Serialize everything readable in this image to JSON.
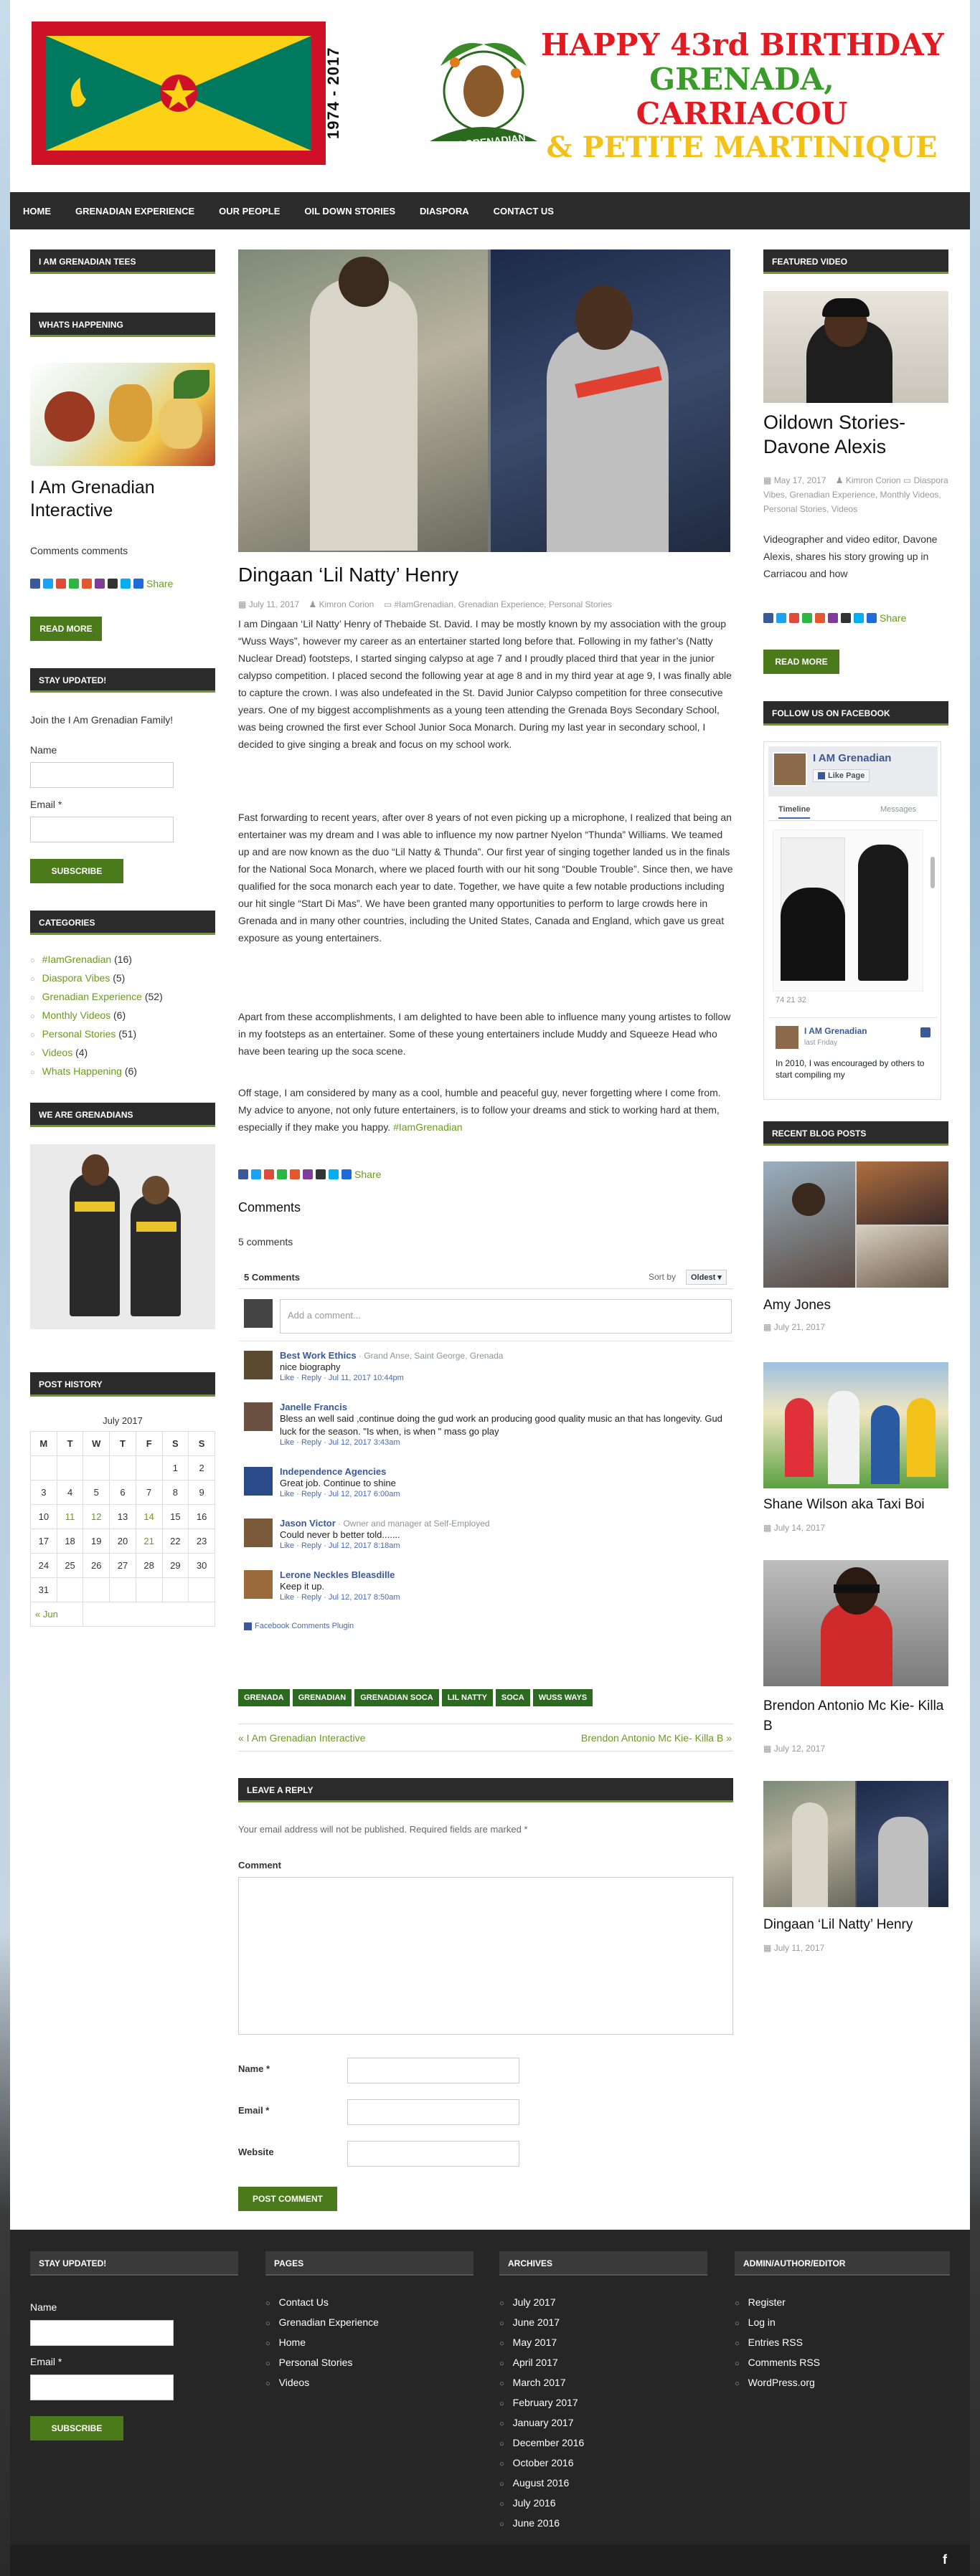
{
  "header": {
    "years": "1974 - 2017",
    "logo_text": "I AM GRENADIAN",
    "line1": "HAPPY 43rd BIRTHDAY",
    "line2": "GRENADA,",
    "line3": "CARRIACOU",
    "line4": "& PETITE MARTINIQUE"
  },
  "nav": [
    "HOME",
    "GRENADIAN EXPERIENCE",
    "OUR PEOPLE",
    "OIL DOWN STORIES",
    "DIASPORA",
    "CONTACT US"
  ],
  "left": {
    "tees_title": "I AM GRENADIAN TEES",
    "happening_title": "WHATS HAPPENING",
    "happening_post": "I Am Grenadian Interactive",
    "happening_comments": "Comments comments",
    "share": "Share",
    "read_more": "READ MORE",
    "stay_title": "STAY UPDATED!",
    "stay_text": "Join the I Am Grenadian Family!",
    "name_label": "Name",
    "email_label": "Email *",
    "subscribe": "SUBSCRIBE",
    "categories_title": "CATEGORIES",
    "categories": [
      {
        "name": "#IamGrenadian",
        "count": "(16)"
      },
      {
        "name": "Diaspora Vibes",
        "count": "(5)"
      },
      {
        "name": "Grenadian Experience",
        "count": "(52)"
      },
      {
        "name": "Monthly Videos",
        "count": "(6)"
      },
      {
        "name": "Personal Stories",
        "count": "(51)"
      },
      {
        "name": "Videos",
        "count": "(4)"
      },
      {
        "name": "Whats Happening",
        "count": "(6)"
      }
    ],
    "we_are_title": "WE ARE GRENADIANS",
    "history_title": "POST HISTORY",
    "cal_caption": "July 2017",
    "cal_head": [
      "M",
      "T",
      "W",
      "T",
      "F",
      "S",
      "S"
    ],
    "cal_rows": [
      [
        "",
        "",
        "",
        "",
        "",
        "1",
        "2"
      ],
      [
        "3",
        "4",
        "5",
        "6",
        "7",
        "8",
        "9"
      ],
      [
        "10",
        "11",
        "12",
        "13",
        "14",
        "15",
        "16"
      ],
      [
        "17",
        "18",
        "19",
        "20",
        "21",
        "22",
        "23"
      ],
      [
        "24",
        "25",
        "26",
        "27",
        "28",
        "29",
        "30"
      ],
      [
        "31",
        "",
        "",
        "",
        "",
        "",
        ""
      ]
    ],
    "cal_prev": "« Jun"
  },
  "post": {
    "title": "Dingaan ‘Lil Natty’ Henry",
    "date": "July 11, 2017",
    "author": "Kimron Corion",
    "cats": "#IamGrenadian, Grenadian Experience, Personal Stories",
    "p1": "I am Dingaan ‘Lil Natty’ Henry of Thebaide St. David. I may be mostly known by my association with the group “Wuss Ways”, however my career as an entertainer started long before that. Following in my father’s (Natty Nuclear Dread) footsteps, I started singing calypso at age 7 and I proudly placed third that year in the junior calypso competition. I placed second the following year at age 8 and in my third year at age 9, I was finally able to capture the crown. I was also undefeated in the St. David Junior Calypso competition for three consecutive years. One of my biggest accomplishments as a young teen attending the Grenada Boys Secondary School, was being crowned the first ever School Junior Soca Monarch. During my last year in secondary school, I decided to give singing a break and focus on my school work.",
    "p2": "Fast forwarding to recent years, after over 8 years of not even picking up a microphone, I realized that being an entertainer was my dream and I was able to influence my now partner Nyelon “Thunda” Williams. We teamed up and are now known as the duo “Lil Natty & Thunda”. Our first year of singing together landed us in the finals for the National Soca Monarch, where we placed fourth with our hit song “Double Trouble”. Since then, we have qualified for the soca monarch each year to date. Together, we have quite a few notable productions including our hit single “Start Di Mas”. We have been granted many opportunities to perform to large crowds here in Grenada and in many other countries, including the United States, Canada and England, which gave us great exposure as young entertainers.",
    "p3": "Apart from these accomplishments, I am delighted to have been able to influence many young artistes to follow in my footsteps as an entertainer. Some of these young entertainers include Muddy and Squeeze Head who have been tearing up the soca scene.",
    "p4a": "Off stage, I am considered by many as a cool, humble and peaceful guy, never forgetting where I come from. My advice to anyone, not only future entertainers, is to follow your dreams and stick to working hard at them, especially if they make you happy.",
    "p4b": "#IamGrenadian",
    "share": "Share",
    "comments_title": "Comments",
    "comments_count": "5 comments",
    "fb_count": "5 Comments",
    "sort_label": "Sort by",
    "sort_value": "Oldest",
    "add_comment": "Add a comment...",
    "comments": [
      {
        "name": "Best Work Ethics",
        "sub": " · Grand Anse, Saint George, Grenada",
        "text": "nice biography",
        "foot": "Like · Reply · Jul 11, 2017 10:44pm"
      },
      {
        "name": "Janelle Francis",
        "sub": "",
        "text": "Bless an well said ,continue doing the gud work an producing good quality music an that has longevity. Gud luck for the season. \"Is when, is when \" mass go play",
        "foot": "Like · Reply · Jul 12, 2017 3:43am"
      },
      {
        "name": "Independence Agencies",
        "sub": "",
        "text": "Great job. Continue to shine",
        "foot": "Like · Reply · Jul 12, 2017 6:00am"
      },
      {
        "name": "Jason Victor",
        "sub": " · Owner and manager at Self-Employed",
        "text": "Could never b better told.......",
        "foot": "Like · Reply · Jul 12, 2017 8:18am"
      },
      {
        "name": "Lerone Neckles Bleasdille",
        "sub": "",
        "text": "Keep it up.",
        "foot": "Like · Reply · Jul 12, 2017 8:50am"
      }
    ],
    "fb_plugin": "Facebook Comments Plugin",
    "tags": [
      "GRENADA",
      "GRENADIAN",
      "GRENADIAN SOCA",
      "LIL NATTY",
      "SOCA",
      "WUSS WAYS"
    ],
    "prev": "« I Am Grenadian Interactive",
    "next": "Brendon Antonio Mc Kie- Killa B »",
    "reply_title": "LEAVE A REPLY",
    "reply_note": "Your email address will not be published. Required fields are marked *",
    "comment_label": "Comment",
    "name_label": "Name *",
    "email_label": "Email *",
    "website_label": "Website",
    "post_comment": "POST COMMENT"
  },
  "right": {
    "featured_title": "FEATURED VIDEO",
    "featured_post": "Oildown Stories- Davone Alexis",
    "featured_date": "May 17, 2017",
    "featured_author": "Kimron Corion",
    "featured_cats": "Diaspora Vibes, Grenadian Experience, Monthly Videos, Personal Stories, Videos",
    "featured_excerpt": "Videographer and video editor, Davone Alexis, shares his story growing up in Carriacou and how",
    "share": "Share",
    "read_more": "READ MORE",
    "fb_title": "FOLLOW US ON FACEBOOK",
    "fb_page": "I AM Grenadian",
    "fb_like": "Like Page",
    "fb_tab1": "Timeline",
    "fb_tab2": "Messages",
    "fb_stats": "74   21   32",
    "fb_post_name": "I AM Grenadian",
    "fb_post_date": "last Friday",
    "fb_post_text": "In 2010, I was encouraged by others to start compiling my",
    "recent_title": "RECENT BLOG POSTS",
    "recent": [
      {
        "title": "Amy Jones",
        "date": "July 21, 2017"
      },
      {
        "title": "Shane Wilson aka Taxi Boi",
        "date": "July 14, 2017"
      },
      {
        "title": "Brendon Antonio Mc Kie- Killa B",
        "date": "July 12, 2017"
      },
      {
        "title": "Dingaan ‘Lil Natty’ Henry",
        "date": "July 11, 2017"
      }
    ]
  },
  "footer": {
    "stay_title": "STAY UPDATED!",
    "name_label": "Name",
    "email_label": "Email *",
    "subscribe": "SUBSCRIBE",
    "pages_title": "PAGES",
    "pages": [
      "Contact Us",
      "Grenadian Experience",
      "Home",
      "Personal Stories",
      "Videos"
    ],
    "archives_title": "ARCHIVES",
    "archives": [
      "July 2017",
      "June 2017",
      "May 2017",
      "April 2017",
      "March 2017",
      "February 2017",
      "January 2017",
      "December 2016",
      "October 2016",
      "August 2016",
      "July 2016",
      "June 2016"
    ],
    "admin_title": "ADMIN/AUTHOR/EDITOR",
    "admin": [
      "Register",
      "Log in",
      "Entries RSS",
      "Comments RSS",
      "WordPress.org"
    ],
    "fb_icon": "f"
  }
}
